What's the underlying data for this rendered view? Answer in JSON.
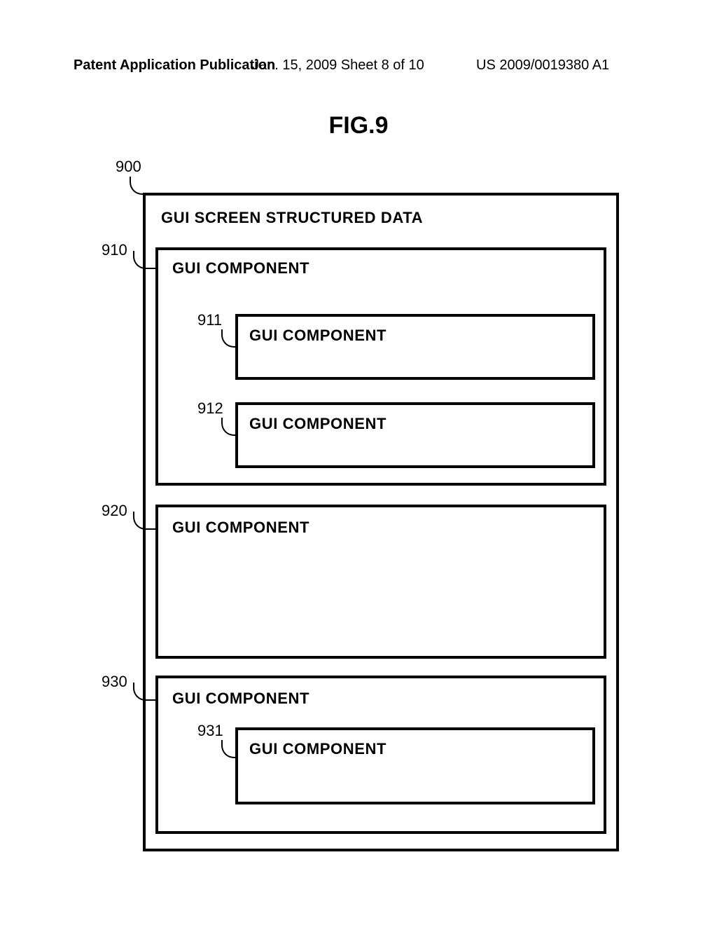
{
  "header": {
    "left": "Patent Application Publication",
    "center": "Jan. 15, 2009  Sheet 8 of 10",
    "right": "US 2009/0019380 A1"
  },
  "figure": {
    "title": "FIG.9",
    "root_label": "GUI SCREEN STRUCTURED DATA",
    "component_label": "GUI COMPONENT",
    "refs": {
      "root": "900",
      "b1": "910",
      "b1a": "911",
      "b1b": "912",
      "b2": "920",
      "b3": "930",
      "b3a": "931"
    }
  }
}
